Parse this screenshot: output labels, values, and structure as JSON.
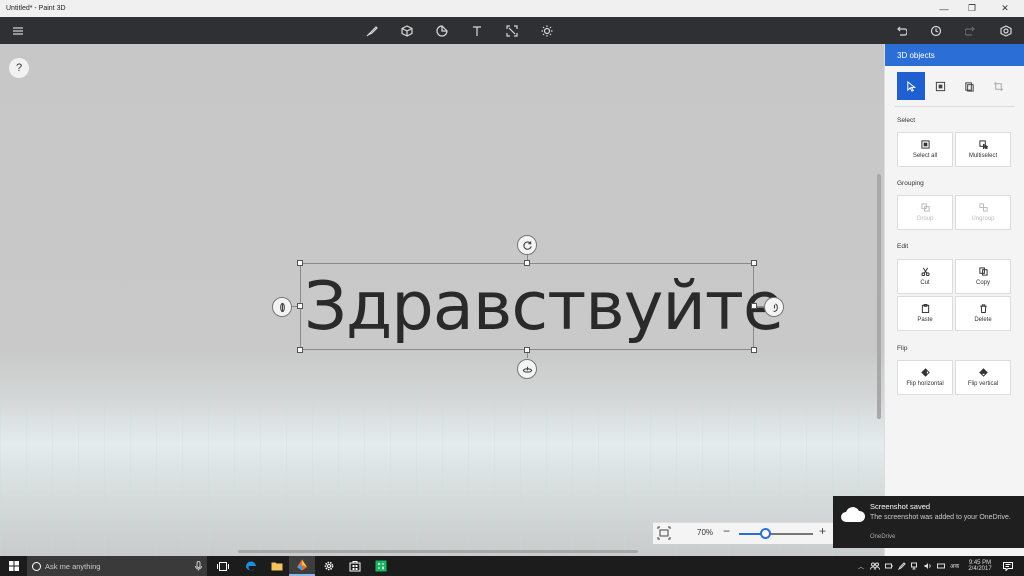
{
  "window": {
    "title": "Untitled* - Paint 3D"
  },
  "toolbar": {
    "menu_icon": "hamburger-menu-icon",
    "tools": [
      "brush-icon",
      "cube-icon",
      "sticker-icon",
      "text-icon",
      "canvas-resize-icon",
      "effects-icon"
    ],
    "right": [
      "undo-icon",
      "history-icon",
      "redo-icon",
      "remix3d-icon"
    ]
  },
  "canvas": {
    "help_label": "?",
    "text_object": "Здравствуйте",
    "zoom": {
      "percent_label": "70%",
      "level_percent": 70,
      "minus": "−",
      "plus": "+"
    }
  },
  "panel": {
    "title": "3D objects",
    "sections": {
      "select": {
        "label": "Select",
        "select_all": "Select all",
        "multiselect": "Multiselect"
      },
      "grouping": {
        "label": "Grouping",
        "group": "Group",
        "ungroup": "Ungroup"
      },
      "edit": {
        "label": "Edit",
        "cut": "Cut",
        "copy": "Copy",
        "paste": "Paste",
        "delete": "Delete"
      },
      "flip": {
        "label": "Flip",
        "flip_horizontal": "Flip horizontal",
        "flip_vertical": "Flip vertical"
      }
    }
  },
  "toast": {
    "title": "Screenshot saved",
    "body": "The screenshot was added to your OneDrive.",
    "source": "OneDrive"
  },
  "taskbar": {
    "search_placeholder": "Ask me anything",
    "language": "अक",
    "time": "9:45 PM",
    "date": "2/4/2017"
  },
  "colors": {
    "accent": "#2b6fd6",
    "toolbar": "#2f3033",
    "taskbar": "#1c1c1c"
  }
}
